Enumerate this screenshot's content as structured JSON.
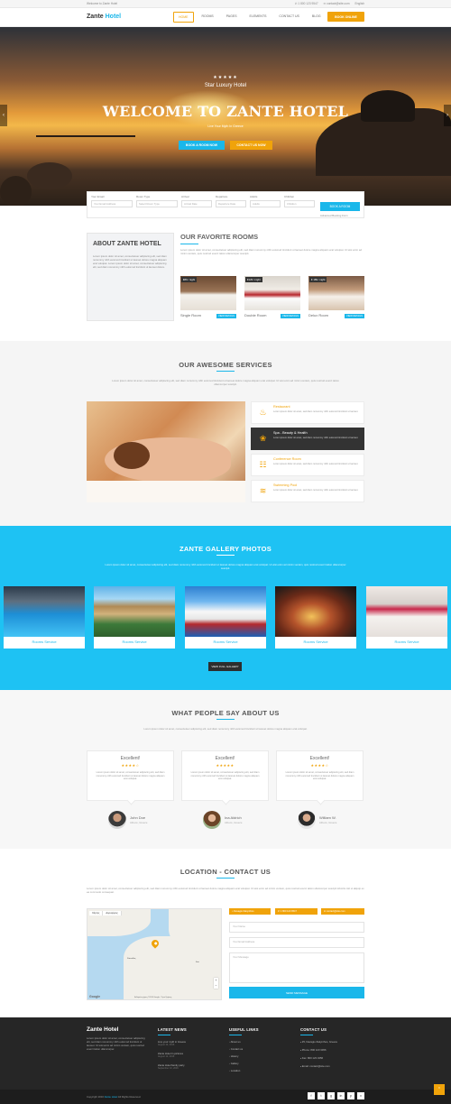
{
  "topbar": {
    "welcome": "Welcome to Zante Hotel",
    "phone": "✆ 1 800 123 9547",
    "email": "✉ contact@site.com",
    "language": "English"
  },
  "header": {
    "logo_main": "Zante",
    "logo_accent": "Hotel",
    "nav": [
      "Home",
      "Rooms",
      "Pages",
      "Elements",
      "Contact Us",
      "Blog"
    ],
    "book_label": "Book Online"
  },
  "hero": {
    "stars": "★★★★★",
    "subtitle": "Star Luxury Hotel",
    "title": "WELCOME TO ZANTE HOTEL",
    "tagline": "Live Your Myth In Greece",
    "btn_book": "Book A Room Now",
    "btn_contact": "Contact Us Now",
    "prev_arrow": "‹",
    "next_arrow": "›"
  },
  "booking": {
    "fields": [
      {
        "label": "Your Email",
        "value": "Your Email Address"
      },
      {
        "label": "Room Type",
        "value": "Select Room Type"
      },
      {
        "label": "Arrival",
        "value": "Arrival Date"
      },
      {
        "label": "Departure",
        "value": "Departure Date"
      },
      {
        "label": "Adults",
        "value": "Adults"
      },
      {
        "label": "Children",
        "value": "Children"
      }
    ],
    "button": "Book A Room",
    "advanced": "Advanced Booking Form"
  },
  "about": {
    "title": "About Zante Hotel",
    "text": "Lorem ipsum dolor sit amet, consectetuer adipiscing elit, sed diam nonummy nibh euismod tincidunt ut laoreet dolore magna aliquam erat volutpat. Lorem ipsum dolor sit amet, consectetuer adipiscing elit, sed diam nonummy nibh euismod tincidunt ut laoreet dolore."
  },
  "favorites": {
    "title": "Our Favorite Rooms",
    "text": "Lorem ipsum dolor sit amet, consectetuer adipiscing elit, sed diam nonummy nibh euismod tincidunt ut laoreet dolore magna aliquam erat volutpat. Ut wisi enim ad minim veniam, quis nostrud exerci tation ullamcorper suscipit.",
    "rooms": [
      {
        "price": "€89 / night",
        "name": "Single Room",
        "more": "View Details"
      },
      {
        "price": "€129 / night",
        "name": "Double Room",
        "more": "View Details"
      },
      {
        "price": "€ 189 / night",
        "name": "Delux Room",
        "more": "View Details"
      }
    ]
  },
  "services": {
    "title": "Our Awesome Services",
    "text": "Lorem ipsum dolor sit amet, consectetuer adipiscing elit, sed diam nonummy nibh euismod tincidunt ut laoreet dolore magna aliquam erat volutpat. Ut wisi enim ad minim veniam, quis nostrud exerci tation ullamcorper suscipit.",
    "items": [
      {
        "title": "Restaurant",
        "text": "Lorem ipsum dolor sit amet, sed diam nonummy nibh euismod tincidunt ut laoreet."
      },
      {
        "title": "Spa - Beauty & Health",
        "text": "Lorem ipsum dolor sit amet, sed diam nonummy nibh euismod tincidunt ut laoreet."
      },
      {
        "title": "Conference Room",
        "text": "Lorem ipsum dolor sit amet, sed diam nonummy nibh euismod tincidunt ut laoreet."
      },
      {
        "title": "Swimming Pool",
        "text": "Lorem ipsum dolor sit amet, sed diam nonummy nibh euismod tincidunt ut laoreet."
      }
    ]
  },
  "gallery": {
    "title": "Zante Gallery Photos",
    "text": "Lorem ipsum dolor sit amet, consectetuer adipiscing elit, sed diam nonummy nibh euismod tincidunt ut laoreet dolore magna aliquam erat volutpat. Ut wisi enim ad minim veniam, quis nostrud exerci tation ullamcorper suscipit.",
    "items": [
      "Rooms Service",
      "Rooms Service",
      "Rooms Service",
      "Rooms Service",
      "Rooms Service"
    ],
    "button": "View Full Gallery"
  },
  "testimonials": {
    "title": "What People Say About Us",
    "text": "Lorem ipsum dolor sit amet, consectetuer adipiscing elit, sed diam nonummy nibh euismod tincidunt ut laoreet dolore magna aliquam erat volutpat.",
    "items": [
      {
        "heading": "Excellent!",
        "stars": "★★★★☆",
        "quote": "Lorem ipsum dolor sit amet, consectetuer adipiscing elit, sed diam nonummy nibh euismod tincidunt ut laoreet dolore magna aliquam erat volutpat.",
        "name": "John Doe",
        "location": "Athens, Greece"
      },
      {
        "heading": "Excellent!",
        "stars": "★★★★★",
        "quote": "Lorem ipsum dolor sit amet, consectetuer adipiscing elit, sed diam nonummy nibh euismod tincidunt ut laoreet dolore magna aliquam erat volutpat.",
        "name": "Ina Aldrich",
        "location": "Athens, Greece"
      },
      {
        "heading": "Excellent!",
        "stars": "★★★★☆",
        "quote": "Lorem ipsum dolor sit amet, consectetuer adipiscing elit, sed diam nonummy nibh euismod tincidunt ut laoreet dolore magna aliquam erat volutpat.",
        "name": "William W.",
        "location": "Athens, Greece"
      }
    ]
  },
  "location": {
    "title": "Location - Contact Us",
    "text": "Lorem ipsum dolor sit amet, consectetuer adipiscing elit, sed diam nonummy nibh euismod tincidunt ut laoreet dolore magna aliquam erat volutpat. Ut wisi enim ad minim veniam, quis nostrud exerci tation ullamcorper suscipit lobortis nisl ut aliquip ex ea commodo consequat.",
    "map_tabs": [
      "Χάρτης",
      "Δορυφόρος"
    ],
    "map_labels": [
      "Ζάκυνθος",
      "Keri"
    ],
    "map_brand": "Google",
    "map_footer": "Δεδομένα χάρτη ©2016 Google · Όροι Χρήσης",
    "contact_address": "Navagio Zakynthos",
    "contact_phone": "1 800 123 9547",
    "contact_email": "contact@site.com",
    "placeholders": {
      "name": "Your Name",
      "email": "Your Email Address",
      "message": "Your Message"
    },
    "send": "Send Message"
  },
  "footer": {
    "logo": "Zante Hotel",
    "about": "Lorem ipsum dolor sit amet, consectetuer adipiscing elit, sed diam nonummy nibh euismod tincidunt ut laoreet. Ut wisi enim ad minim veniam, quis nostrud exerci tation ullamcorper.",
    "news_title": "Latest News",
    "news": [
      {
        "title": "Live your myth in Greece",
        "date": "August 14, 2016"
      },
      {
        "title": "Zante Hotel in pictures",
        "date": "August 12, 2016"
      },
      {
        "title": "Zante Hotel family party",
        "date": "September 10, 2016"
      }
    ],
    "links_title": "Useful Links",
    "links": [
      "About us",
      "Contact us",
      "History",
      "Gallery",
      "Location"
    ],
    "contact_title": "Contact Us",
    "contact": [
      "25, Navagio Zakynthos, Greece",
      "Phone: 800 123 3456",
      "Fax: 800 123 3456",
      "Email: contact@site.com"
    ],
    "copyright_a": "Copyright 2016",
    "copyright_b": "Zante Hotel",
    "copyright_c": "All Rights Reserved.",
    "social": [
      "f",
      "t",
      "g",
      "in",
      "p",
      "v"
    ]
  },
  "backtop": "⌃"
}
